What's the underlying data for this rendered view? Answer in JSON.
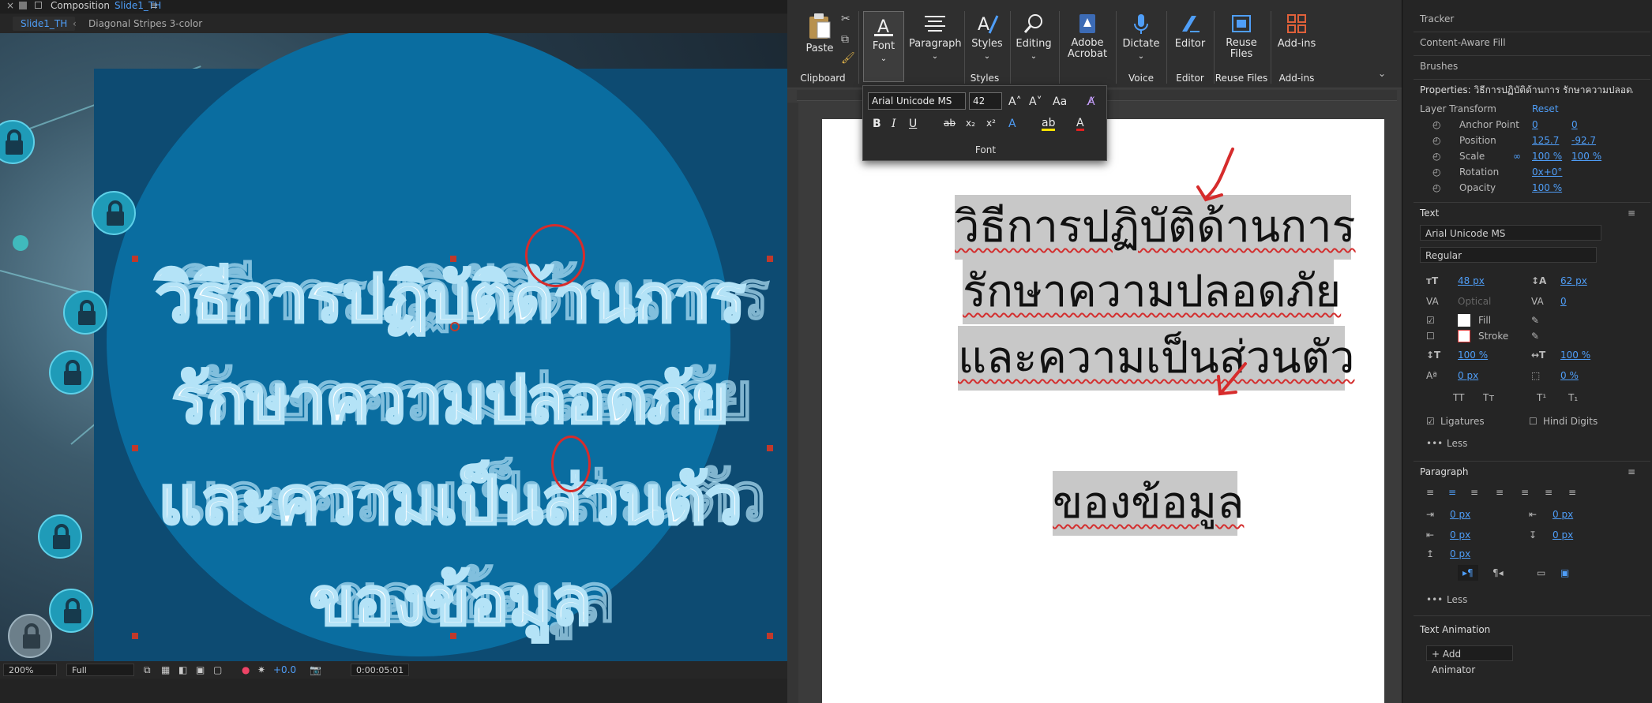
{
  "ae": {
    "title": "Composition",
    "comp_name": "Slide1_TH",
    "tab_active": "Slide1_TH",
    "tab_layer": "Diagonal Stripes 3-color",
    "text_lines": [
      "วิธีการปฏิบัติด้านการ",
      "รักษาความปลอดภัย",
      "และความเป็นส่วนตัว",
      "ของข้อมูล"
    ],
    "status": {
      "zoom": "200%",
      "resolution": "Full",
      "exposure": "+0.0",
      "timecode": "0:00:05:01"
    }
  },
  "word": {
    "ribbon": {
      "paste": "Paste",
      "font": "Font",
      "paragraph": "Paragraph",
      "styles": "Styles",
      "editing": "Editing",
      "adobe": "Adobe Acrobat",
      "dictate": "Dictate",
      "editor": "Editor",
      "reuse": "Reuse Files",
      "addins": "Add-ins",
      "groups": {
        "clipboard": "Clipboard",
        "styles": "Styles",
        "voice": "Voice",
        "editor": "Editor",
        "reuse": "Reuse Files",
        "addins": "Add-ins"
      }
    },
    "font_flyout": {
      "font_name": "Arial Unicode MS",
      "font_size": "42",
      "group_label": "Font"
    },
    "document_lines": [
      "วิธีการปฏิบัติด้านการ",
      "รักษาความปลอดภัย",
      "และความเป็นส่วนตัว",
      "ของข้อมูล"
    ]
  },
  "props": {
    "top_items": [
      "Tracker",
      "Content-Aware Fill",
      "Brushes"
    ],
    "header": "Properties: วิธีการปฏิบัติด้านการ รักษาความปลอดภั",
    "layer_transform": "Layer Transform",
    "reset": "Reset",
    "transform": [
      {
        "label": "Anchor Point",
        "v1": "0",
        "v2": "0"
      },
      {
        "label": "Position",
        "v1": "125.7",
        "v2": "-92.7"
      },
      {
        "label": "Scale",
        "v1": "100 %",
        "v2": "100 %"
      },
      {
        "label": "Rotation",
        "v1": "0x+0°",
        "v2": ""
      },
      {
        "label": "Opacity",
        "v1": "100 %",
        "v2": ""
      }
    ],
    "text_section": "Text",
    "font": "Arial Unicode MS",
    "style": "Regular",
    "font_size": "48 px",
    "leading": "62 px",
    "kerning": "Optical",
    "tracking": "0",
    "fill": "Fill",
    "stroke": "Stroke",
    "vscale": "100 %",
    "hscale": "100 %",
    "baseline": "0 px",
    "tsume": "0 %",
    "caps": [
      "TT",
      "Tт",
      "T¹",
      "T₁"
    ],
    "ligatures": "Ligatures",
    "hindi_digits": "Hindi Digits",
    "less": "Less",
    "paragraph_section": "Paragraph",
    "para_values": [
      "0 px",
      "0 px",
      "0 px",
      "0 px",
      "0 px"
    ],
    "text_animation": "Text Animation",
    "add_animator": "Add Animator"
  }
}
